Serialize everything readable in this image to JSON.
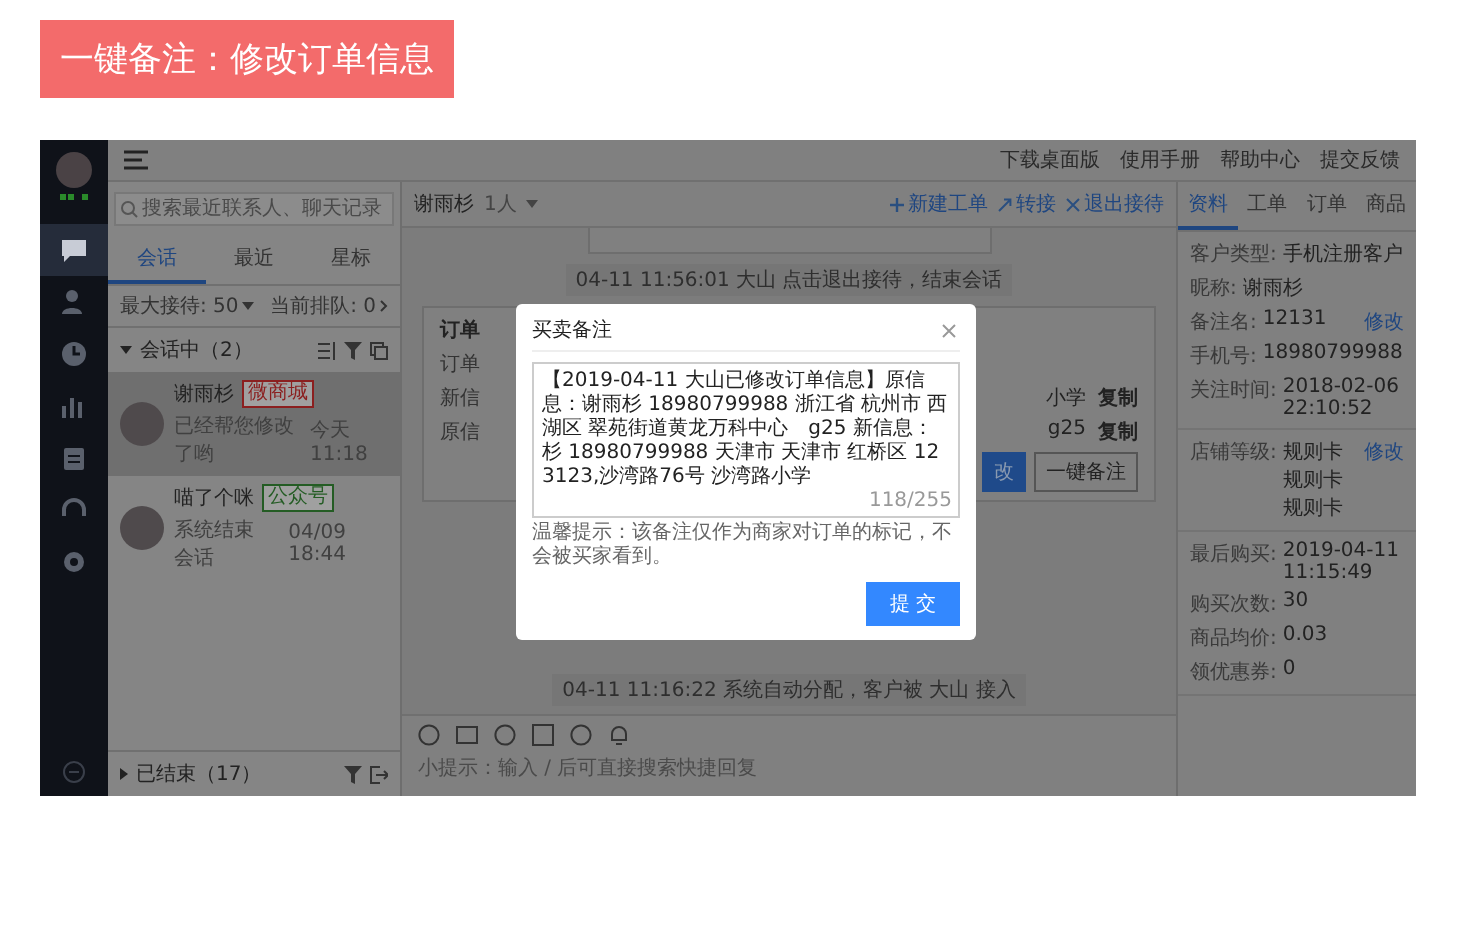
{
  "banner": {
    "title": "一键备注：修改订单信息"
  },
  "sidebar": {
    "items": [
      {
        "selected": true
      },
      {
        "selected": false
      },
      {
        "selected": false
      },
      {
        "selected": false
      },
      {
        "selected": false
      },
      {
        "selected": false
      },
      {
        "selected": false
      }
    ]
  },
  "topbar": {
    "links": [
      "下载桌面版",
      "使用手册",
      "帮助中心",
      "提交反馈"
    ]
  },
  "conversations": {
    "search": {
      "placeholder": "搜索最近联系人、聊天记录"
    },
    "tabs": [
      {
        "label": "会话",
        "selected": true
      },
      {
        "label": "最近",
        "selected": false
      },
      {
        "label": "星标",
        "selected": false
      }
    ],
    "max_reception": "最大接待: 50",
    "queue": "当前排队: 0",
    "active_group": {
      "label": "会话中（2）",
      "items": [
        {
          "name": "谢雨杉",
          "tag": "微商城",
          "color": "#8b1f1f",
          "preview": "已经帮您修改了哟",
          "time": "今天 11:18",
          "selected": true
        },
        {
          "name": "喵了个咪",
          "tag": "公众号",
          "color": "#245c24",
          "preview": "系统结束会话",
          "time": "04/09 18:44",
          "selected": false
        }
      ]
    },
    "ended_group": {
      "label": "已结束（17）"
    }
  },
  "chat": {
    "name": "谢雨杉",
    "count": "1人",
    "actions": [
      "新建工单",
      "转接",
      "退出接待"
    ],
    "system_messages": [
      "04-11 11:56:01 大山 点击退出接待，结束会话",
      "04-11 11:16:22 系统自动分配，客户被 大山 接入"
    ],
    "order_card": {
      "title": "订单",
      "rows": [
        {
          "label": "订单",
          "value": "",
          "copy": ""
        },
        {
          "label": "新信",
          "value": "小学",
          "copy": "复制"
        },
        {
          "label": "原信",
          "value": "g25",
          "copy": "复制"
        }
      ],
      "buttons": [
        "改",
        "一键备注"
      ]
    },
    "compose": {
      "placeholder": "小提示：输入 / 后可直接搜索快捷回复"
    }
  },
  "profile": {
    "tabs": [
      {
        "label": "资料",
        "selected": true
      },
      {
        "label": "工单",
        "selected": false
      },
      {
        "label": "订单",
        "selected": false
      },
      {
        "label": "商品",
        "selected": false
      }
    ],
    "sections": [
      [
        {
          "label": "客户类型:",
          "value": "手机注册客户"
        },
        {
          "label": "昵称:",
          "value": "谢雨杉"
        },
        {
          "label": "备注名:",
          "value": "12131",
          "action": "修改"
        },
        {
          "label": "手机号:",
          "value": "18980799988"
        },
        {
          "label": "关注时间:",
          "value": "2018-02-06 22:10:52"
        }
      ],
      [
        {
          "label": "店铺等级:",
          "value": "规则卡规则卡规则卡",
          "action": "修改"
        }
      ],
      [
        {
          "label": "最后购买:",
          "value": "2019-04-11 11:15:49"
        },
        {
          "label": "购买次数:",
          "value": "30"
        },
        {
          "label": "商品均价:",
          "value": "0.03"
        },
        {
          "label": "领优惠券:",
          "value": "0"
        }
      ]
    ]
  },
  "modal": {
    "title": "买卖备注",
    "remark": "【2019-04-11 大山已修改订单信息】原信息：谢雨杉 18980799988 浙江省 杭州市 西湖区 翠苑街道黄龙万科中心　g25 新信息：杉 18980799988 天津市 天津市 红桥区 123123,沙湾路76号 沙湾路小学",
    "counter": "118/255",
    "hint": "温馨提示：该备注仅作为商家对订单的标记，不会被买家看到。",
    "submit": "提 交"
  }
}
